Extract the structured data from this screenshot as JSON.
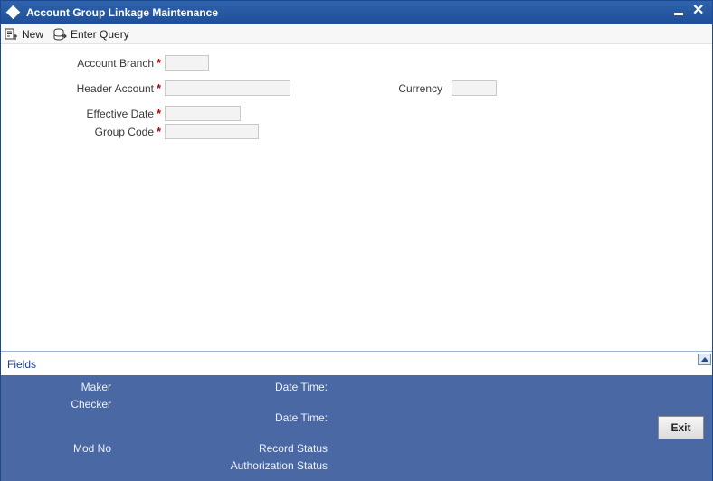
{
  "window": {
    "title": "Account Group Linkage Maintenance",
    "minimize_symbol": "–",
    "close_symbol": "✕"
  },
  "toolbar": {
    "new_label": "New",
    "enter_query_label": "Enter Query"
  },
  "form": {
    "account_branch": {
      "label": "Account Branch",
      "required_mark": "*",
      "value": ""
    },
    "header_account": {
      "label": "Header Account",
      "required_mark": "*",
      "value": ""
    },
    "currency": {
      "label": "Currency",
      "value": ""
    },
    "effective_date": {
      "label": "Effective Date",
      "required_mark": "*",
      "value": ""
    },
    "group_code": {
      "label": "Group Code",
      "required_mark": "*",
      "value": ""
    }
  },
  "fields_link": "Fields",
  "audit": {
    "maker": "Maker",
    "checker": "Checker",
    "date_time_1": "Date Time:",
    "date_time_2": "Date Time:",
    "mod_no": "Mod No",
    "record_status": "Record Status",
    "authorization_status": "Authorization Status",
    "exit_label": "Exit"
  },
  "colors": {
    "titlebar": "#2a5ba6",
    "audit_panel": "#4a68a4",
    "required": "#c00000",
    "link": "#1a3f9a"
  }
}
